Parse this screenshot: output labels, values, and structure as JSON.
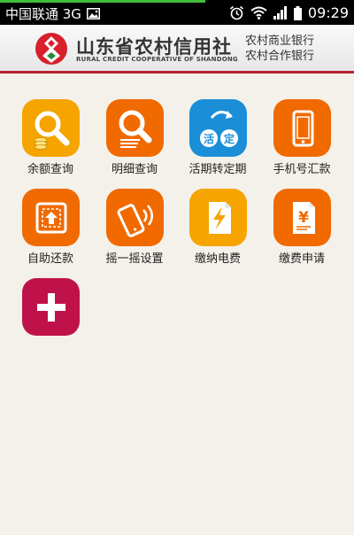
{
  "status_bar": {
    "carrier": "中国联通 3G",
    "time": "09:29",
    "progress_fraction": 0.58,
    "icons": [
      "image-icon",
      "alarm-icon",
      "wifi-icon",
      "signal-icon",
      "battery-icon"
    ]
  },
  "header": {
    "bank_name": "山东省农村信用社",
    "bank_name_en": "RURAL CREDIT COOPERATIVE OF SHANDONG",
    "side_line_1": "农村商业银行",
    "side_line_2": "农村合作银行",
    "accent_color": "#b8232f"
  },
  "menu": [
    {
      "label": "余额查询",
      "icon": "balance-inquiry-icon",
      "color": "#f5a400"
    },
    {
      "label": "明细查询",
      "icon": "detail-inquiry-icon",
      "color": "#f06a00"
    },
    {
      "label": "活期转定期",
      "icon": "current-to-fixed-icon",
      "color": "#1a8fd8"
    },
    {
      "label": "手机号汇款",
      "icon": "mobile-remit-icon",
      "color": "#f06a00"
    },
    {
      "label": "自助还款",
      "icon": "self-repay-icon",
      "color": "#f06a00"
    },
    {
      "label": "摇一摇设置",
      "icon": "shake-settings-icon",
      "color": "#f06a00"
    },
    {
      "label": "缴纳电费",
      "icon": "electricity-icon",
      "color": "#f5a400"
    },
    {
      "label": "缴费申请",
      "icon": "payment-apply-icon",
      "color": "#f06a00"
    }
  ],
  "add_button": {
    "icon": "plus-icon",
    "color": "#c0124a"
  }
}
